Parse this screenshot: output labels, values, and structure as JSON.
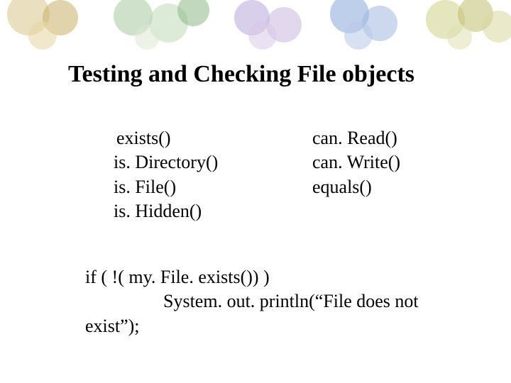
{
  "slide": {
    "title": "Testing and Checking File objects",
    "left_col": {
      "l1": "exists()",
      "l2": "is. Directory()",
      "l3": "is. File()",
      "l4": "is. Hidden()"
    },
    "right_col": {
      "r1": "can. Read()",
      "r2": "can. Write()",
      "r3": "equals()"
    },
    "code": {
      "line1": "if (  !( my. File. exists())  )",
      "line2": "System. out. println(“File does not",
      "line3": "exist”);"
    }
  }
}
